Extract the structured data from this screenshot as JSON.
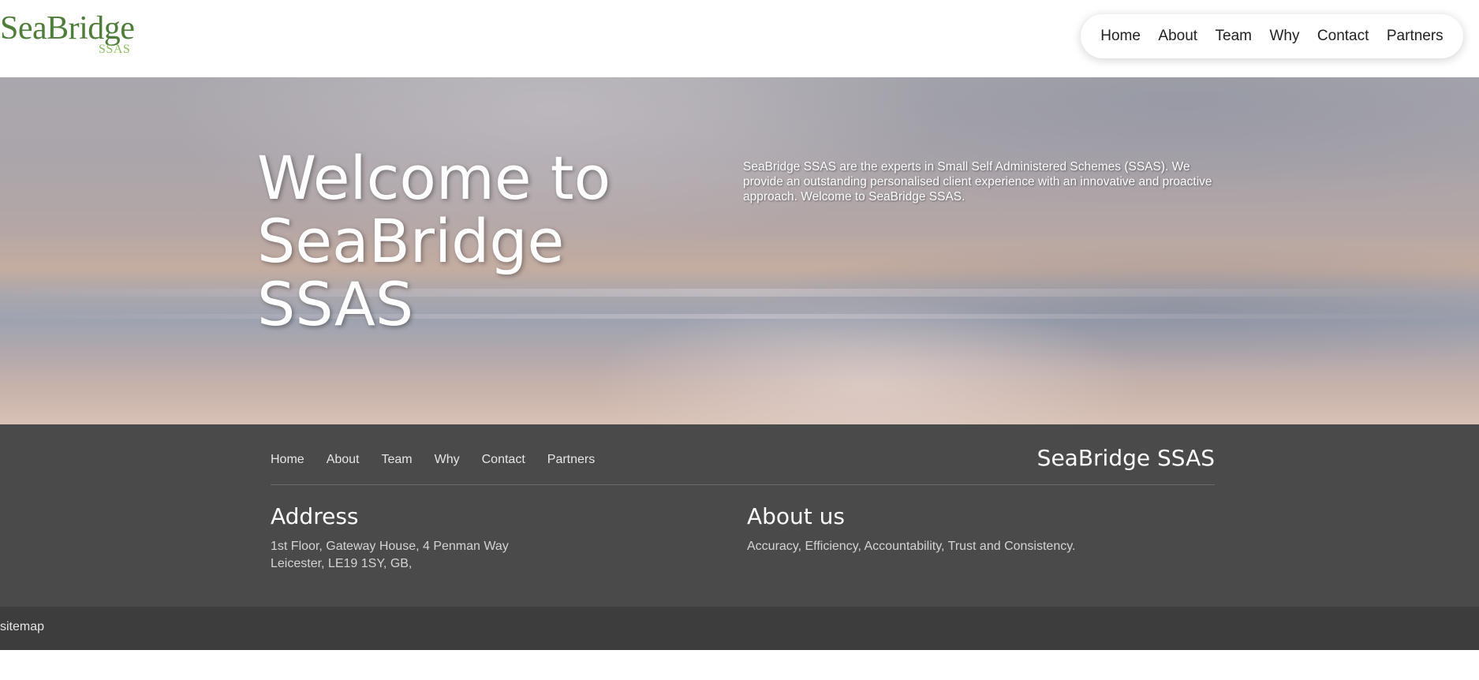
{
  "header": {
    "logo": {
      "main": "SeaBridge",
      "sub": "SSAS"
    },
    "nav": [
      "Home",
      "About",
      "Team",
      "Why",
      "Contact",
      "Partners"
    ]
  },
  "hero": {
    "title_lines": [
      "Welcome to",
      "SeaBridge",
      "SSAS"
    ],
    "text": "SeaBridge SSAS are the experts in Small Self Administered Schemes (SSAS). We provide an outstanding personalised client experience with an innovative and proactive approach. Welcome to SeaBridge SSAS."
  },
  "footer": {
    "nav": [
      "Home",
      "About",
      "Team",
      "Why",
      "Contact",
      "Partners"
    ],
    "brand": "SeaBridge SSAS",
    "address": {
      "heading": "Address",
      "lines": [
        "1st Floor, Gateway House, 4 Penman Way",
        "Leicester, LE19 1SY, GB,"
      ]
    },
    "about": {
      "heading": "About us",
      "text": "Accuracy, Efficiency, Accountability, Trust and Consistency."
    }
  },
  "bottom_bar": {
    "sitemap": "sitemap"
  },
  "colors": {
    "logo_green": "#4f7d3a",
    "logo_light_green": "#8bbb5e",
    "footer_bg": "#4a4a4a",
    "bottom_bar_bg": "#3d3d3d"
  }
}
